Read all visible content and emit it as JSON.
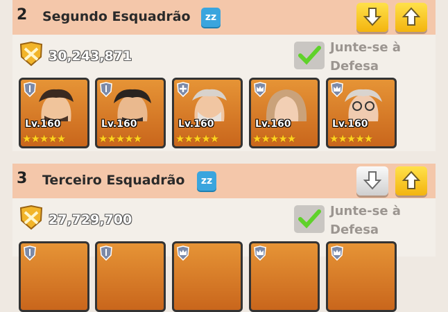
{
  "squads": [
    {
      "number": "2",
      "name": "Segundo Esquadrão",
      "sleep_icon": "zz",
      "power": "30,243,871",
      "defense_label": "Junte-se à Defesa",
      "heroes": [
        {
          "level": "Lv.160",
          "stars": "★★★★★",
          "badge": "shield"
        },
        {
          "level": "Lv.160",
          "stars": "★★★★★",
          "badge": "shield"
        },
        {
          "level": "Lv.160",
          "stars": "★★★★★",
          "badge": "plus"
        },
        {
          "level": "Lv.160",
          "stars": "★★★★★",
          "badge": "crown"
        },
        {
          "level": "Lv.160",
          "stars": "★★★★★",
          "badge": "crown"
        }
      ]
    },
    {
      "number": "3",
      "name": "Terceiro Esquadrão",
      "sleep_icon": "zz",
      "power": "27,729,700",
      "defense_label": "Junte-se à Defesa"
    }
  ]
}
